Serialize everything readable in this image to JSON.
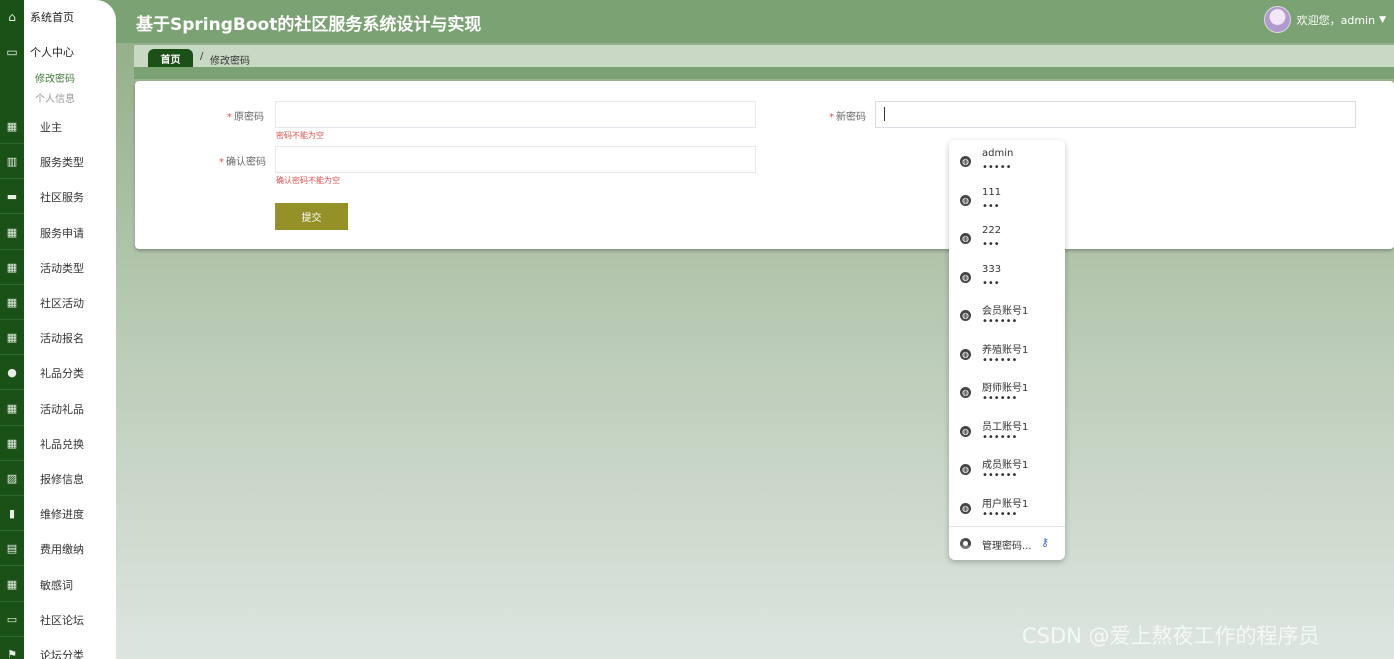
{
  "header": {
    "title": "基于SpringBoot的社区服务系统设计与实现",
    "welcome": "欢迎您，admin"
  },
  "sidebar": {
    "home": "系统首页",
    "personal_center": "个人中心",
    "sub_items": [
      "修改密码",
      "个人信息"
    ],
    "items": [
      {
        "label": "业主",
        "icon": "grid-icon"
      },
      {
        "label": "服务类型",
        "icon": "book-icon"
      },
      {
        "label": "社区服务",
        "icon": "briefcase-icon"
      },
      {
        "label": "服务申请",
        "icon": "grid-icon"
      },
      {
        "label": "活动类型",
        "icon": "grid-icon"
      },
      {
        "label": "社区活动",
        "icon": "grid-icon"
      },
      {
        "label": "活动报名",
        "icon": "grid-icon"
      },
      {
        "label": "礼品分类",
        "icon": "user-icon"
      },
      {
        "label": "活动礼品",
        "icon": "grid-icon"
      },
      {
        "label": "礼品兑换",
        "icon": "grid-icon"
      },
      {
        "label": "报修信息",
        "icon": "chart-line-icon"
      },
      {
        "label": "维修进度",
        "icon": "bar-chart-icon"
      },
      {
        "label": "费用缴纳",
        "icon": "clipboard-icon"
      },
      {
        "label": "敏感词",
        "icon": "grid-icon"
      },
      {
        "label": "社区论坛",
        "icon": "inbox-icon"
      },
      {
        "label": "论坛分类",
        "icon": "flag-icon"
      }
    ]
  },
  "breadcrumb": {
    "home": "首页",
    "separator": "/",
    "current": "修改密码"
  },
  "form": {
    "old_password_label": "原密码",
    "old_password_error": "密码不能为空",
    "new_password_label": "新密码",
    "confirm_password_label": "确认密码",
    "confirm_password_error": "确认密码不能为空",
    "submit_label": "提交",
    "required_mark": "*"
  },
  "password_suggestions": {
    "items": [
      {
        "user": "admin",
        "dots": "•••••"
      },
      {
        "user": "111",
        "dots": "•••"
      },
      {
        "user": "222",
        "dots": "•••"
      },
      {
        "user": "333",
        "dots": "•••"
      },
      {
        "user": "会员账号1",
        "dots": "••••••"
      },
      {
        "user": "养殖账号1",
        "dots": "••••••"
      },
      {
        "user": "厨师账号1",
        "dots": "••••••"
      },
      {
        "user": "员工账号1",
        "dots": "••••••"
      },
      {
        "user": "成员账号1",
        "dots": "••••••"
      },
      {
        "user": "用户账号1",
        "dots": "••••••"
      }
    ],
    "manage_label": "管理密码..."
  },
  "watermark": "CSDN @爱上熬夜工作的程序员",
  "colors": {
    "header": "#7ba273",
    "sidebar_strip": "#1a5117",
    "submit": "#949128",
    "error": "#e05050"
  }
}
